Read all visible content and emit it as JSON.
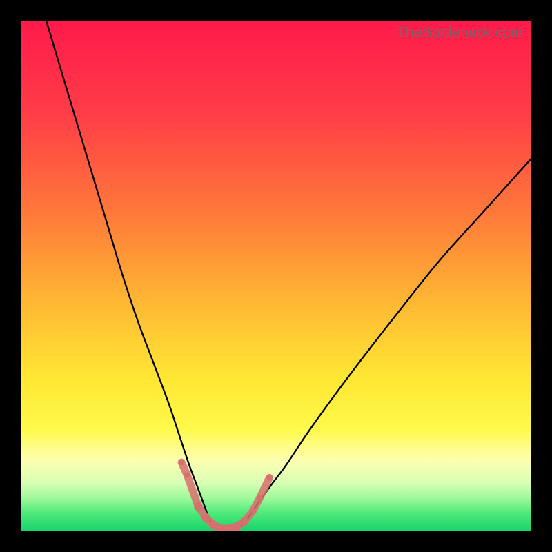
{
  "watermark": "TheBottleneck.com",
  "chart_data": {
    "type": "line",
    "title": "",
    "xlabel": "",
    "ylabel": "",
    "xlim": [
      0,
      100
    ],
    "ylim": [
      0,
      100
    ],
    "grid": false,
    "legend": false,
    "gradient_stops": [
      {
        "offset": 0.0,
        "color": "#ff1a4b"
      },
      {
        "offset": 0.18,
        "color": "#ff3c47"
      },
      {
        "offset": 0.38,
        "color": "#ff7a3a"
      },
      {
        "offset": 0.55,
        "color": "#ffb733"
      },
      {
        "offset": 0.7,
        "color": "#ffe733"
      },
      {
        "offset": 0.8,
        "color": "#fff94a"
      },
      {
        "offset": 0.86,
        "color": "#fdffb0"
      },
      {
        "offset": 0.905,
        "color": "#d8ffb4"
      },
      {
        "offset": 0.935,
        "color": "#9ef99a"
      },
      {
        "offset": 0.965,
        "color": "#4de97a"
      },
      {
        "offset": 1.0,
        "color": "#17d36a"
      }
    ],
    "series": [
      {
        "name": "left-branch",
        "stroke": "#000000",
        "x": [
          5,
          8,
          11,
          14,
          17,
          20,
          23,
          26,
          29,
          31,
          33,
          34.5,
          35.8,
          36.7,
          37.3
        ],
        "y": [
          100,
          90,
          80,
          70,
          60,
          50,
          41,
          33,
          25,
          19,
          13,
          9,
          5.5,
          3,
          1.5
        ]
      },
      {
        "name": "right-branch",
        "stroke": "#000000",
        "x": [
          43.8,
          44.8,
          46.5,
          49,
          52,
          56,
          61,
          67,
          74,
          82,
          91,
          100
        ],
        "y": [
          1.5,
          3,
          5.5,
          9,
          13,
          19,
          26,
          34,
          43,
          53,
          63,
          73
        ]
      },
      {
        "name": "valley-floor",
        "stroke": "#000000",
        "x": [
          37.3,
          38.5,
          40,
          41.5,
          43,
          43.8
        ],
        "y": [
          1.5,
          0.7,
          0.4,
          0.5,
          0.9,
          1.5
        ]
      }
    ],
    "markers": [
      {
        "name": "valley-markers",
        "color": "#d86e6e",
        "x": [
          31.5,
          32.6,
          34.8,
          36.3,
          37.8,
          39.3,
          40.8,
          42.3,
          43.8,
          45.5,
          46.8,
          48.7
        ],
        "y": [
          13.5,
          11.0,
          4.8,
          2.6,
          1.2,
          0.5,
          0.5,
          0.9,
          1.9,
          4.0,
          6.5,
          10.5
        ],
        "r": [
          4.2,
          4.2,
          6.2,
          6.2,
          6.2,
          6.2,
          6.2,
          6.2,
          6.2,
          4.2,
          4.2,
          4.2
        ]
      }
    ]
  }
}
